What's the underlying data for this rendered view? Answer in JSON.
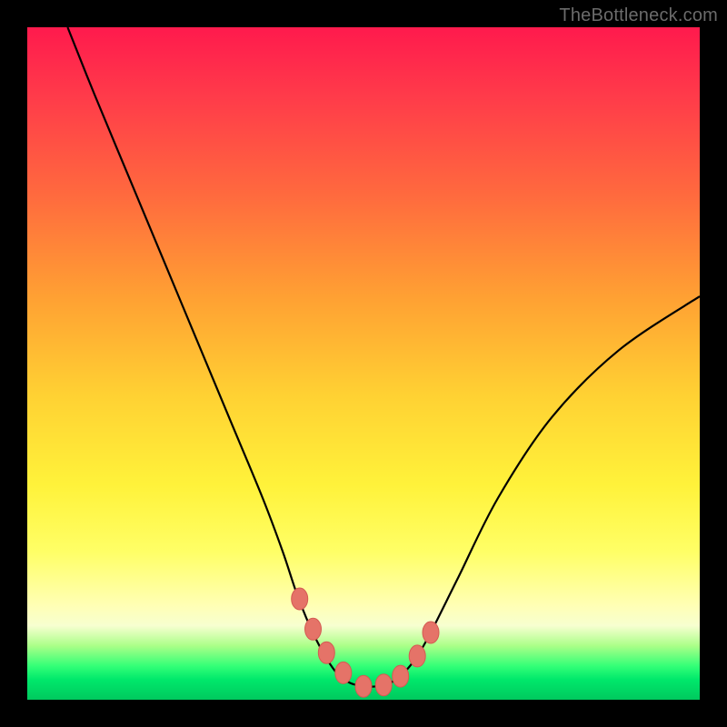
{
  "watermark": "TheBottleneck.com",
  "colors": {
    "background_black": "#000000",
    "gradient_top": "#ff1a4d",
    "gradient_mid": "#fff23a",
    "gradient_green": "#00e86b",
    "curve_stroke": "#000000",
    "marker_fill": "#e57368",
    "watermark_text": "#6b6b6b"
  },
  "chart_data": {
    "type": "line",
    "title": "",
    "xlabel": "",
    "ylabel": "",
    "xlim": [
      0,
      100
    ],
    "ylim": [
      0,
      100
    ],
    "series": [
      {
        "name": "bottleneck-curve",
        "x": [
          6,
          10,
          15,
          20,
          25,
          30,
          35,
          38,
          40,
          42,
          44,
          46,
          48,
          50,
          52,
          54,
          56,
          58,
          60,
          64,
          70,
          78,
          88,
          100
        ],
        "y": [
          100,
          90,
          78,
          66,
          54,
          42,
          30,
          22,
          16,
          11,
          7,
          4,
          2.5,
          2,
          2,
          2.5,
          4,
          6.5,
          10,
          18,
          30,
          42,
          52,
          60
        ]
      }
    ],
    "markers": {
      "name": "highlighted-points",
      "x": [
        40.5,
        42.5,
        44.5,
        47,
        50,
        53,
        55.5,
        58,
        60
      ],
      "y": [
        15,
        10.5,
        7,
        4,
        2,
        2.2,
        3.5,
        6.5,
        10
      ]
    },
    "notes": "Y-axis is inverted visually (0 at bottom of gradient area, 100 at top). Curve resembles an asymmetric V / valley with minimum near x≈50–54, left branch steep reaching top-left, right branch shallower ending around y≈60 at right edge. Small salmon-colored oval markers cluster at the valley bottom. No axis ticks or labels are visible; values are estimated from pixel positions."
  }
}
